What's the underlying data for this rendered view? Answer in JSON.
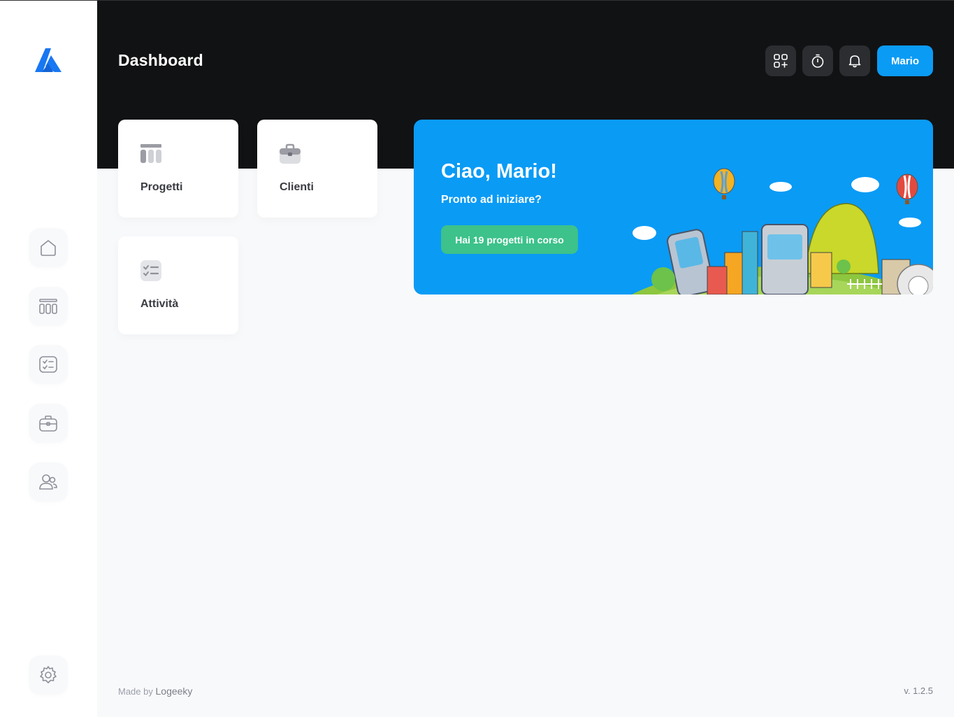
{
  "header": {
    "title": "Dashboard",
    "user_label": "Mario"
  },
  "header_icons": [
    "apps-add-icon",
    "timer-icon",
    "bell-icon"
  ],
  "sidebar": {
    "items": [
      {
        "icon": "home-icon"
      },
      {
        "icon": "projects-icon"
      },
      {
        "icon": "tasks-icon"
      },
      {
        "icon": "briefcase-icon"
      },
      {
        "icon": "users-icon"
      }
    ],
    "settings_icon": "gear-icon"
  },
  "cards": {
    "projects": {
      "label": "Progetti",
      "icon": "projects-icon"
    },
    "clients": {
      "label": "Clienti",
      "icon": "briefcase-icon"
    },
    "tasks": {
      "label": "Attività",
      "icon": "tasks-icon"
    }
  },
  "banner": {
    "title": "Ciao, Mario!",
    "subtitle": "Pronto ad iniziare?",
    "button": "Hai 19 progetti in corso"
  },
  "footer": {
    "made_by": "Made by",
    "brand": "Logeeky",
    "version": "v. 1.2.5"
  },
  "colors": {
    "accent": "#0a9bf5",
    "success": "#3cc28a",
    "header_bg": "#111214",
    "logo": "#1877f2"
  }
}
